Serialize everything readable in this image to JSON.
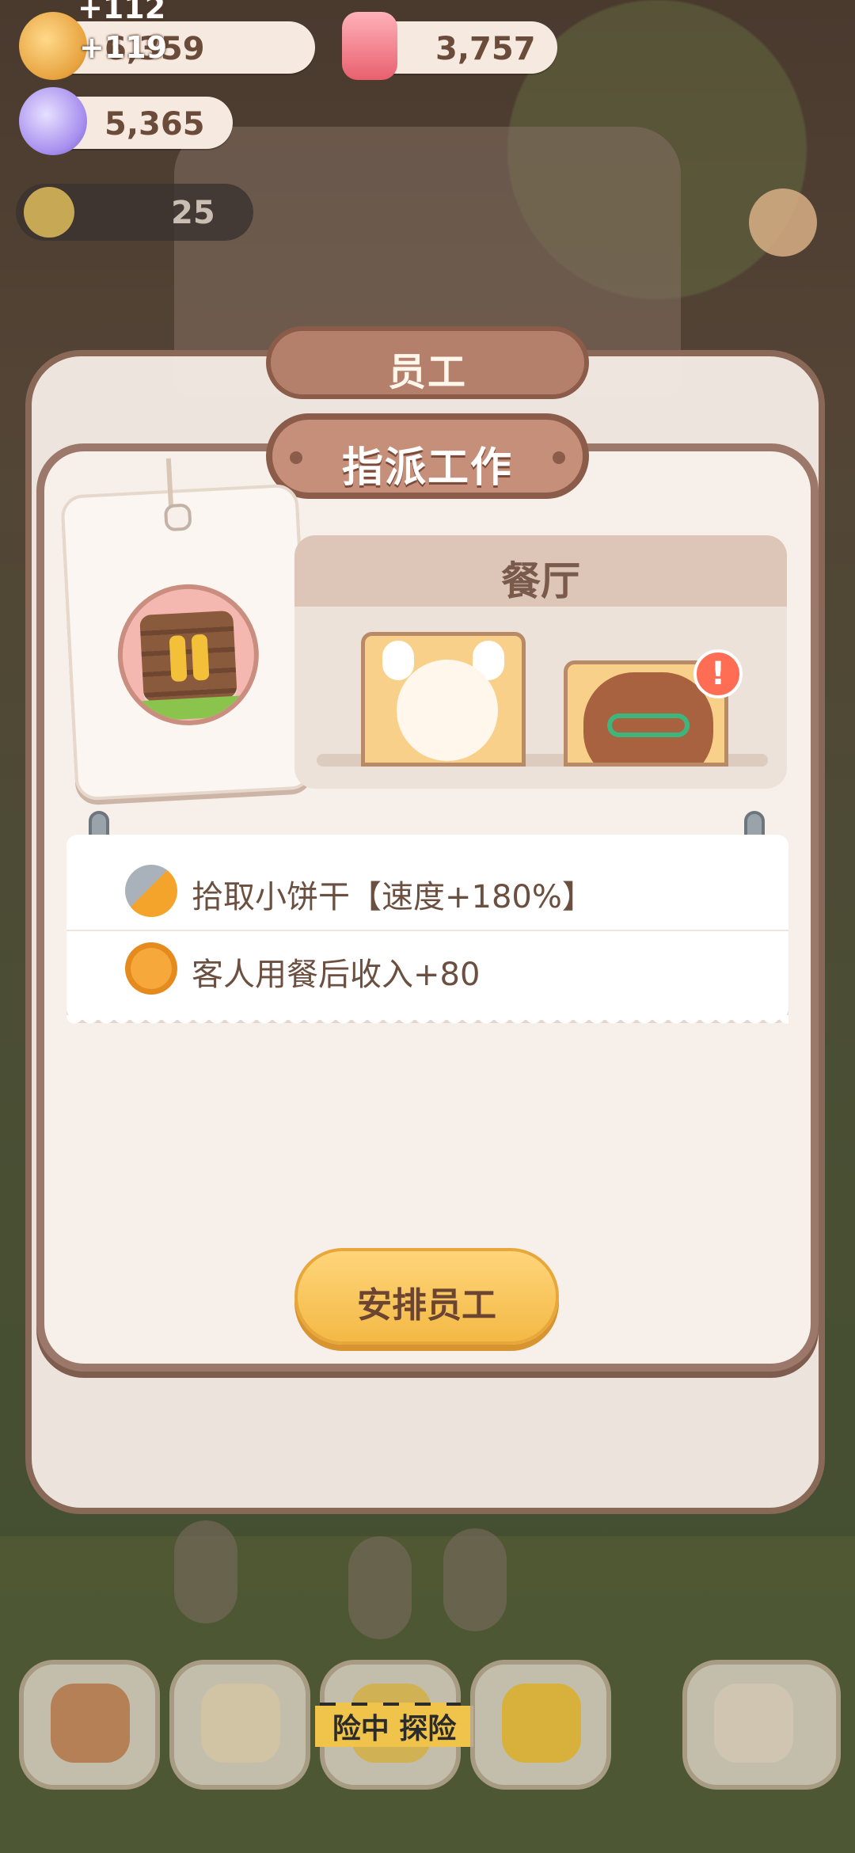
{
  "currencies": {
    "cookies": {
      "value": "6,359",
      "float_a": "+112",
      "float_b": "+119"
    },
    "candles": {
      "value": "3,757"
    },
    "candy": {
      "value": "5,365"
    }
  },
  "hud": {
    "level_value": "25"
  },
  "modal": {
    "title": "员工"
  },
  "dialog": {
    "title": "指派工作",
    "section_title": "餐厅",
    "alert_glyph": "!",
    "effects": [
      {
        "icon": "cookie-pickup-icon",
        "text": "拾取小饼干【速度+180%】"
      },
      {
        "icon": "meal-income-icon",
        "text": "客人用餐后收入+80"
      }
    ],
    "button_label": "安排员工"
  },
  "bottom_nav": {
    "explore_label": "险中 探险"
  },
  "colors": {
    "button": "#f3b945",
    "header": "#c58f79",
    "panel": "#f7efe9",
    "text": "#6b4f40"
  }
}
